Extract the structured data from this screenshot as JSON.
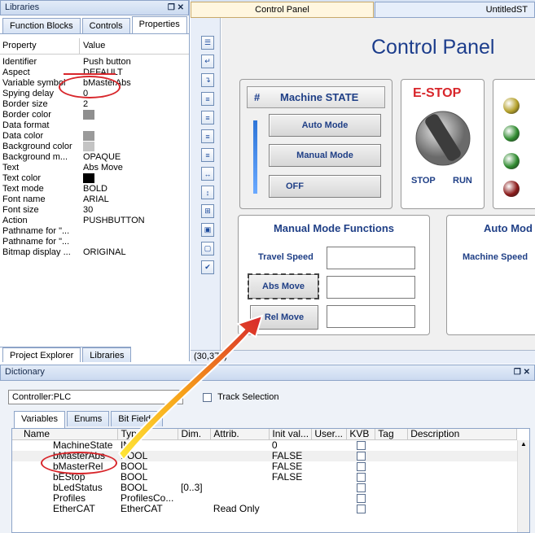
{
  "libraries_panel": {
    "title": "Libraries",
    "pin_close": "❐ ✕",
    "tabs": [
      {
        "label": "Function Blocks"
      },
      {
        "label": "Controls"
      },
      {
        "label": "Properties"
      }
    ],
    "col_property": "Property",
    "col_value": "Value",
    "rows": [
      {
        "k": "Identifier",
        "v": "Push button"
      },
      {
        "k": "Aspect",
        "v": "DEFAULT"
      },
      {
        "k": "Variable symbol",
        "v": "bMasterAbs"
      },
      {
        "k": "Spying delay",
        "v": "0"
      },
      {
        "k": "Border size",
        "v": "2"
      },
      {
        "k": "Border color",
        "v": "",
        "color": "#8f8f8f"
      },
      {
        "k": "Data format",
        "v": ""
      },
      {
        "k": "Data color",
        "v": "",
        "color": "#9a9a9a"
      },
      {
        "k": "Background color",
        "v": "",
        "color": "#c4c4c4"
      },
      {
        "k": "Background m...",
        "v": "OPAQUE"
      },
      {
        "k": "Text",
        "v": "Abs Move"
      },
      {
        "k": "Text color",
        "v": "",
        "color": "#000000"
      },
      {
        "k": "Text mode",
        "v": "BOLD"
      },
      {
        "k": "Font name",
        "v": "ARIAL"
      },
      {
        "k": "Font size",
        "v": "30"
      },
      {
        "k": "Action",
        "v": "PUSHBUTTON"
      },
      {
        "k": "Pathname for \"...",
        "v": ""
      },
      {
        "k": "Pathname for \"...",
        "v": ""
      },
      {
        "k": "Bitmap display ...",
        "v": "ORIGINAL"
      }
    ],
    "bottom_tabs": [
      {
        "label": "Project Explorer"
      },
      {
        "label": "Libraries"
      }
    ]
  },
  "doc_tabs": [
    {
      "label": "Control Panel"
    },
    {
      "label": "UntitledST"
    }
  ],
  "toolbar_icons": [
    "goto-icon",
    "page-icon",
    "page-arrow-icon",
    "align-left-icon",
    "align-top-icon",
    "align-right-icon",
    "align-bottom-icon",
    "space-horizontal-icon",
    "space-vertical-icon",
    "grid-icon",
    "bring-front-icon",
    "send-back-icon",
    "check-icon"
  ],
  "canvas": {
    "title": "Control Panel",
    "machine_state": {
      "hash": "#",
      "title": "Machine STATE",
      "buttons": [
        {
          "label": "Auto Mode"
        },
        {
          "label": "Manual Mode"
        },
        {
          "label": "OFF"
        }
      ]
    },
    "estop": {
      "title": "E-STOP",
      "stop": "STOP",
      "run": "RUN"
    },
    "manual": {
      "title": "Manual Mode Functions",
      "travel_speed": "Travel Speed",
      "abs_move": "Abs Move",
      "rel_move": "Rel Move"
    },
    "auto": {
      "title": "Auto Mod",
      "machine_speed": "Machine Speed"
    },
    "leds": [
      "#b4a02a",
      "#2f8a2f",
      "#2f8a2f",
      "#8a1a1a"
    ],
    "coords": "(30,379)"
  },
  "dictionary": {
    "title": "Dictionary",
    "pin_close": "❐ ✕",
    "controller": "Controller:PLC",
    "track_selection": "Track Selection",
    "tabs": [
      {
        "label": "Variables"
      },
      {
        "label": "Enums"
      },
      {
        "label": "Bit Fields"
      }
    ],
    "columns": [
      "Name",
      "Type",
      "Dim.",
      "Attrib.",
      "Init val...",
      "User...",
      "KVB",
      "Tag",
      "Description"
    ],
    "rows": [
      {
        "name": "MachineState",
        "type": "INT",
        "dim": "",
        "attrib": "",
        "init": "0",
        "kvb": true
      },
      {
        "name": "bMasterAbs",
        "type": "BOOL",
        "dim": "",
        "attrib": "",
        "init": "FALSE",
        "kvb": true
      },
      {
        "name": "bMasterRel",
        "type": "BOOL",
        "dim": "",
        "attrib": "",
        "init": "FALSE",
        "kvb": true
      },
      {
        "name": "bEStop",
        "type": "BOOL",
        "dim": "",
        "attrib": "",
        "init": "FALSE",
        "kvb": true
      },
      {
        "name": "bLedStatus",
        "type": "BOOL",
        "dim": "[0..3]",
        "attrib": "",
        "init": "",
        "kvb": true
      },
      {
        "name": "Profiles",
        "type": "ProfilesCo...",
        "dim": "",
        "attrib": "",
        "init": "",
        "kvb": true
      },
      {
        "name": "EtherCAT",
        "type": "EtherCAT",
        "dim": "",
        "attrib": "Read Only",
        "init": "",
        "kvb": true
      }
    ]
  }
}
